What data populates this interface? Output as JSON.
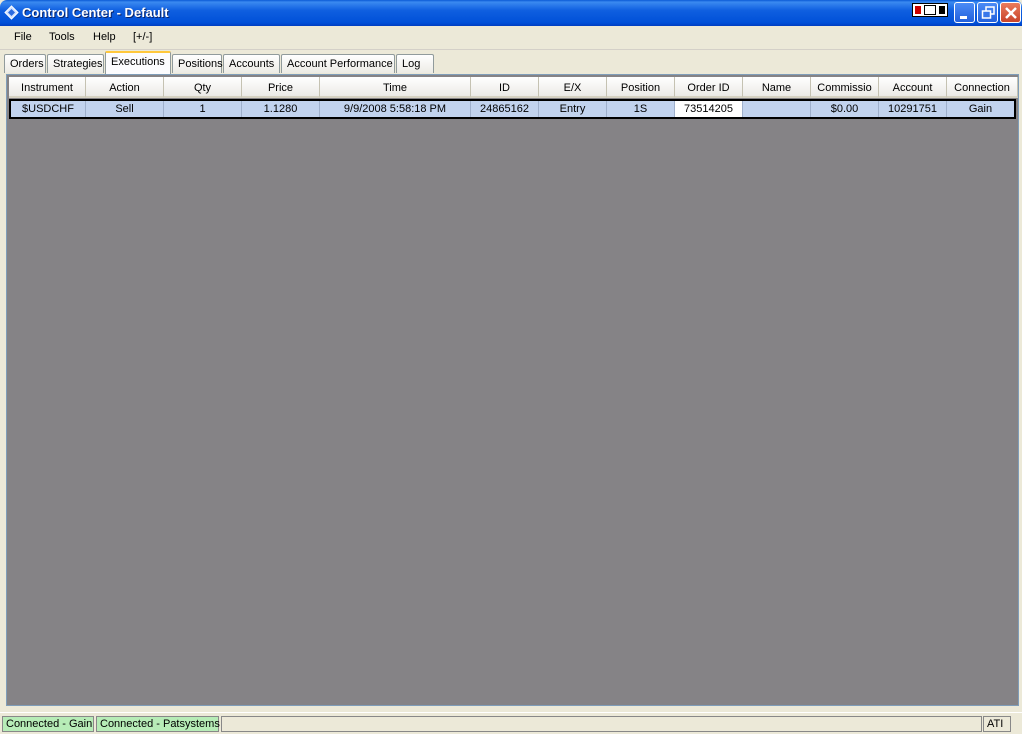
{
  "window": {
    "title": "Control Center - Default"
  },
  "menu": {
    "items": [
      "File",
      "Tools",
      "Help",
      "[+/-]"
    ]
  },
  "tabs": [
    "Orders",
    "Strategies",
    "Executions",
    "Positions",
    "Accounts",
    "Account Performance",
    "Log"
  ],
  "active_tab": "Executions",
  "grid": {
    "columns": [
      "Instrument",
      "Action",
      "Qty",
      "Price",
      "Time",
      "ID",
      "E/X",
      "Position",
      "Order ID",
      "Name",
      "Commissio",
      "Account",
      "Connection"
    ],
    "rows": [
      [
        "$USDCHF",
        "Sell",
        "1",
        "1.1280",
        "9/9/2008 5:58:18 PM",
        "24865162",
        "Entry",
        "1S",
        "73514205",
        "",
        "$0.00",
        "10291751",
        "Gain"
      ]
    ]
  },
  "status": {
    "panels": [
      "Connected - Gain",
      "Connected - Patsystems",
      "",
      "ATI"
    ]
  },
  "colors": {
    "titlebar": "#0050d8",
    "grid_background": "#858386",
    "row_highlight": "#c2d3ee",
    "status_connected": "#b7ecb7",
    "active_tab_accent": "#ffc83c"
  },
  "icons": [
    "app-diamond-icon",
    "minimize-icon",
    "restore-icon",
    "close-icon"
  ]
}
